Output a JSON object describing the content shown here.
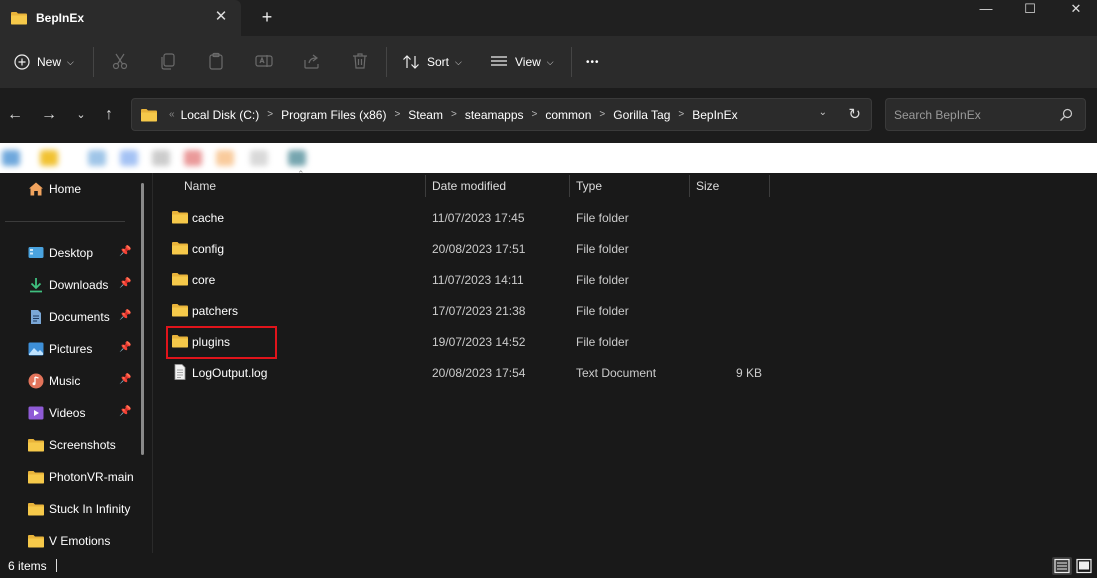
{
  "window": {
    "tab_title": "BepInEx",
    "tab_close": "✕",
    "new_tab": "+",
    "minimize": "—",
    "maximize": "☐",
    "close": "✕"
  },
  "toolbar": {
    "new_label": "New",
    "sort_label": "Sort",
    "view_label": "View",
    "more_label": "•••"
  },
  "address": {
    "overflow": "«",
    "crumbs": [
      "Local Disk (C:)",
      "Program Files (x86)",
      "Steam",
      "steamapps",
      "common",
      "Gorilla Tag",
      "BepInEx"
    ],
    "crumb_separator": ">"
  },
  "search": {
    "placeholder": "Search BepInEx"
  },
  "sidebar": {
    "home": "Home",
    "items": [
      {
        "label": "Desktop",
        "icon": "desktop-icon",
        "pinned": true
      },
      {
        "label": "Downloads",
        "icon": "download-icon",
        "pinned": true
      },
      {
        "label": "Documents",
        "icon": "document-icon",
        "pinned": true
      },
      {
        "label": "Pictures",
        "icon": "picture-icon",
        "pinned": true
      },
      {
        "label": "Music",
        "icon": "music-icon",
        "pinned": true
      },
      {
        "label": "Videos",
        "icon": "video-icon",
        "pinned": true
      },
      {
        "label": "Screenshots",
        "icon": "folder-icon",
        "pinned": false
      },
      {
        "label": "PhotonVR-main",
        "icon": "folder-icon",
        "pinned": false
      },
      {
        "label": "Stuck In Infinity",
        "icon": "folder-icon",
        "pinned": false
      },
      {
        "label": "V Emotions",
        "icon": "folder-icon",
        "pinned": false
      }
    ]
  },
  "columns": {
    "name": "Name",
    "date": "Date modified",
    "type": "Type",
    "size": "Size"
  },
  "files": [
    {
      "name": "cache",
      "date": "11/07/2023 17:45",
      "type": "File folder",
      "size": "",
      "icon": "folder-icon"
    },
    {
      "name": "config",
      "date": "20/08/2023 17:51",
      "type": "File folder",
      "size": "",
      "icon": "folder-icon"
    },
    {
      "name": "core",
      "date": "11/07/2023 14:11",
      "type": "File folder",
      "size": "",
      "icon": "folder-icon"
    },
    {
      "name": "patchers",
      "date": "17/07/2023 21:38",
      "type": "File folder",
      "size": "",
      "icon": "folder-icon"
    },
    {
      "name": "plugins",
      "date": "19/07/2023 14:52",
      "type": "File folder",
      "size": "",
      "icon": "folder-icon"
    },
    {
      "name": "LogOutput.log",
      "date": "20/08/2023 17:54",
      "type": "Text Document",
      "size": "9 KB",
      "icon": "text-file-icon"
    }
  ],
  "status": {
    "item_count": "6 items"
  },
  "colors": {
    "background": "#191919",
    "toolbar": "#2b2b2b",
    "folder": "#f3c13a",
    "highlight": "#e0141b"
  }
}
